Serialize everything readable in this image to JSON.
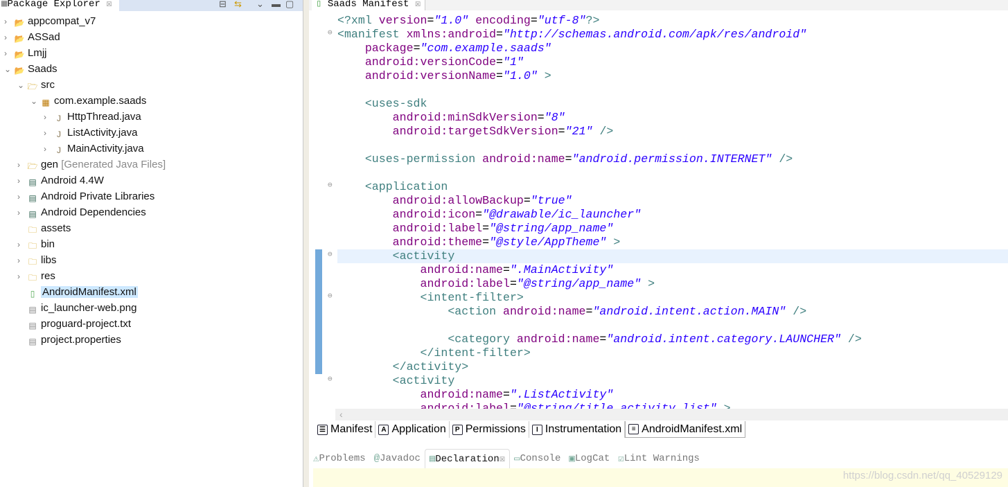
{
  "explorer": {
    "title": "Package Explorer",
    "items": [
      {
        "level": 0,
        "arrow": "›",
        "icon": "project-folder-icon",
        "label": "appcompat_v7"
      },
      {
        "level": 0,
        "arrow": "›",
        "icon": "project-folder-icon",
        "label": "ASSad"
      },
      {
        "level": 0,
        "arrow": "›",
        "icon": "project-folder-icon",
        "label": "Lmjj"
      },
      {
        "level": 0,
        "arrow": "⌄",
        "icon": "project-folder-icon",
        "label": "Saads"
      },
      {
        "level": 1,
        "arrow": "⌄",
        "icon": "source-folder-icon",
        "label": "src"
      },
      {
        "level": 2,
        "arrow": "⌄",
        "icon": "package-icon",
        "label": "com.example.saads"
      },
      {
        "level": 3,
        "arrow": "›",
        "icon": "java-file-icon",
        "label": "HttpThread.java"
      },
      {
        "level": 3,
        "arrow": "›",
        "icon": "java-file-icon",
        "label": "ListActivity.java"
      },
      {
        "level": 3,
        "arrow": "›",
        "icon": "java-file-icon",
        "label": "MainActivity.java"
      },
      {
        "level": 1,
        "arrow": "›",
        "icon": "source-folder-icon",
        "label": "gen",
        "extra": "[Generated Java Files]"
      },
      {
        "level": 1,
        "arrow": "›",
        "icon": "library-icon",
        "label": "Android 4.4W"
      },
      {
        "level": 1,
        "arrow": "›",
        "icon": "library-icon",
        "label": "Android Private Libraries"
      },
      {
        "level": 1,
        "arrow": "›",
        "icon": "library-icon",
        "label": "Android Dependencies"
      },
      {
        "level": 1,
        "arrow": "",
        "icon": "folder-icon",
        "label": "assets"
      },
      {
        "level": 1,
        "arrow": "›",
        "icon": "folder-icon",
        "label": "bin"
      },
      {
        "level": 1,
        "arrow": "›",
        "icon": "folder-icon",
        "label": "libs"
      },
      {
        "level": 1,
        "arrow": "›",
        "icon": "folder-icon",
        "label": "res"
      },
      {
        "level": 1,
        "arrow": "",
        "icon": "xml-file-icon",
        "label": "AndroidManifest.xml",
        "selected": true
      },
      {
        "level": 1,
        "arrow": "",
        "icon": "file-icon",
        "label": "ic_launcher-web.png"
      },
      {
        "level": 1,
        "arrow": "",
        "icon": "file-icon",
        "label": "proguard-project.txt"
      },
      {
        "level": 1,
        "arrow": "",
        "icon": "file-icon",
        "label": "project.properties"
      }
    ]
  },
  "editor": {
    "title": "Saads Manifest",
    "lines": [
      {
        "i": 0,
        "t": [
          [
            "tag",
            "<?xml "
          ],
          [
            "attr",
            "version"
          ],
          [
            "eq",
            "="
          ],
          [
            "val",
            "\"1.0\""
          ],
          [
            "attr",
            " encoding"
          ],
          [
            "eq",
            "="
          ],
          [
            "val",
            "\"utf-8\""
          ],
          [
            "tag",
            "?>"
          ]
        ]
      },
      {
        "i": 0,
        "fold": true,
        "t": [
          [
            "tag",
            "<manifest "
          ],
          [
            "attr",
            "xmlns:android"
          ],
          [
            "eq",
            "="
          ],
          [
            "val",
            "\"http://schemas.android.com/apk/res/android\""
          ]
        ]
      },
      {
        "i": 1,
        "t": [
          [
            "attr",
            "package"
          ],
          [
            "eq",
            "="
          ],
          [
            "val",
            "\"com.example.saads\""
          ]
        ]
      },
      {
        "i": 1,
        "t": [
          [
            "attr",
            "android:versionCode"
          ],
          [
            "eq",
            "="
          ],
          [
            "val",
            "\"1\""
          ]
        ]
      },
      {
        "i": 1,
        "t": [
          [
            "attr",
            "android:versionName"
          ],
          [
            "eq",
            "="
          ],
          [
            "val",
            "\"1.0\""
          ],
          [
            "tag",
            " >"
          ]
        ]
      },
      {
        "i": 0,
        "t": []
      },
      {
        "i": 1,
        "t": [
          [
            "tag",
            "<uses-sdk"
          ]
        ]
      },
      {
        "i": 2,
        "t": [
          [
            "attr",
            "android:minSdkVersion"
          ],
          [
            "eq",
            "="
          ],
          [
            "val",
            "\"8\""
          ]
        ]
      },
      {
        "i": 2,
        "t": [
          [
            "attr",
            "android:targetSdkVersion"
          ],
          [
            "eq",
            "="
          ],
          [
            "val",
            "\"21\""
          ],
          [
            "tag",
            " />"
          ]
        ]
      },
      {
        "i": 0,
        "t": []
      },
      {
        "i": 1,
        "t": [
          [
            "tag",
            "<uses-permission "
          ],
          [
            "attr",
            "android:name"
          ],
          [
            "eq",
            "="
          ],
          [
            "val",
            "\"android.permission.INTERNET\""
          ],
          [
            "tag",
            " />"
          ]
        ]
      },
      {
        "i": 0,
        "t": []
      },
      {
        "i": 1,
        "fold": true,
        "t": [
          [
            "tag",
            "<application"
          ]
        ]
      },
      {
        "i": 2,
        "t": [
          [
            "attr",
            "android:allowBackup"
          ],
          [
            "eq",
            "="
          ],
          [
            "val",
            "\"true\""
          ]
        ]
      },
      {
        "i": 2,
        "t": [
          [
            "attr",
            "android:icon"
          ],
          [
            "eq",
            "="
          ],
          [
            "val",
            "\"@drawable/ic_launcher\""
          ]
        ]
      },
      {
        "i": 2,
        "t": [
          [
            "attr",
            "android:label"
          ],
          [
            "eq",
            "="
          ],
          [
            "val",
            "\"@string/app_name\""
          ]
        ]
      },
      {
        "i": 2,
        "t": [
          [
            "attr",
            "android:theme"
          ],
          [
            "eq",
            "="
          ],
          [
            "val",
            "\"@style/AppTheme\""
          ],
          [
            "tag",
            " >"
          ]
        ]
      },
      {
        "i": 2,
        "fold": true,
        "hl": true,
        "t": [
          [
            "tag",
            "<activity"
          ]
        ]
      },
      {
        "i": 3,
        "t": [
          [
            "attr",
            "android:name"
          ],
          [
            "eq",
            "="
          ],
          [
            "val",
            "\".MainActivity\""
          ]
        ]
      },
      {
        "i": 3,
        "t": [
          [
            "attr",
            "android:label"
          ],
          [
            "eq",
            "="
          ],
          [
            "val",
            "\"@string/app_name\""
          ],
          [
            "tag",
            " >"
          ]
        ]
      },
      {
        "i": 3,
        "fold": true,
        "t": [
          [
            "tag",
            "<intent-filter>"
          ]
        ]
      },
      {
        "i": 4,
        "t": [
          [
            "tag",
            "<action "
          ],
          [
            "attr",
            "android:name"
          ],
          [
            "eq",
            "="
          ],
          [
            "val",
            "\"android.intent.action.MAIN\""
          ],
          [
            "tag",
            " />"
          ]
        ]
      },
      {
        "i": 0,
        "t": []
      },
      {
        "i": 4,
        "t": [
          [
            "tag",
            "<category "
          ],
          [
            "attr",
            "android:name"
          ],
          [
            "eq",
            "="
          ],
          [
            "val",
            "\"android.intent.category.LAUNCHER\""
          ],
          [
            "tag",
            " />"
          ]
        ]
      },
      {
        "i": 3,
        "t": [
          [
            "tag",
            "</intent-filter>"
          ]
        ]
      },
      {
        "i": 2,
        "t": [
          [
            "tag",
            "</activity>"
          ]
        ]
      },
      {
        "i": 2,
        "fold": true,
        "t": [
          [
            "tag",
            "<activity"
          ]
        ]
      },
      {
        "i": 3,
        "t": [
          [
            "attr",
            "android:name"
          ],
          [
            "eq",
            "="
          ],
          [
            "val",
            "\".ListActivity\""
          ]
        ]
      },
      {
        "i": 3,
        "t": [
          [
            "attr",
            "android:label"
          ],
          [
            "eq",
            "="
          ],
          [
            "val",
            "\"@string/title_activity_list\""
          ],
          [
            "tag",
            " >"
          ]
        ]
      }
    ],
    "page_tabs": [
      {
        "icon": "manifest-icon",
        "glyph": "☰",
        "label": "Manifest"
      },
      {
        "icon": "application-icon",
        "glyph": "A",
        "label": "Application"
      },
      {
        "icon": "permissions-icon",
        "glyph": "P",
        "label": "Permissions"
      },
      {
        "icon": "instrumentation-icon",
        "glyph": "I",
        "label": "Instrumentation"
      },
      {
        "icon": "xml-file-icon",
        "glyph": "≡",
        "label": "AndroidManifest.xml",
        "active": true
      }
    ]
  },
  "bottom": {
    "tabs": [
      {
        "icon": "problems-icon",
        "glyph": "⚠",
        "label": "Problems"
      },
      {
        "icon": "javadoc-icon",
        "glyph": "@",
        "label": "Javadoc"
      },
      {
        "icon": "declaration-icon",
        "glyph": "▤",
        "label": "Declaration",
        "active": true
      },
      {
        "icon": "console-icon",
        "glyph": "▭",
        "label": "Console"
      },
      {
        "icon": "logcat-icon",
        "glyph": "▣",
        "label": "LogCat"
      },
      {
        "icon": "lint-icon",
        "glyph": "☑",
        "label": "Lint Warnings"
      }
    ]
  },
  "watermark": "https://blog.csdn.net/qq_40529129"
}
